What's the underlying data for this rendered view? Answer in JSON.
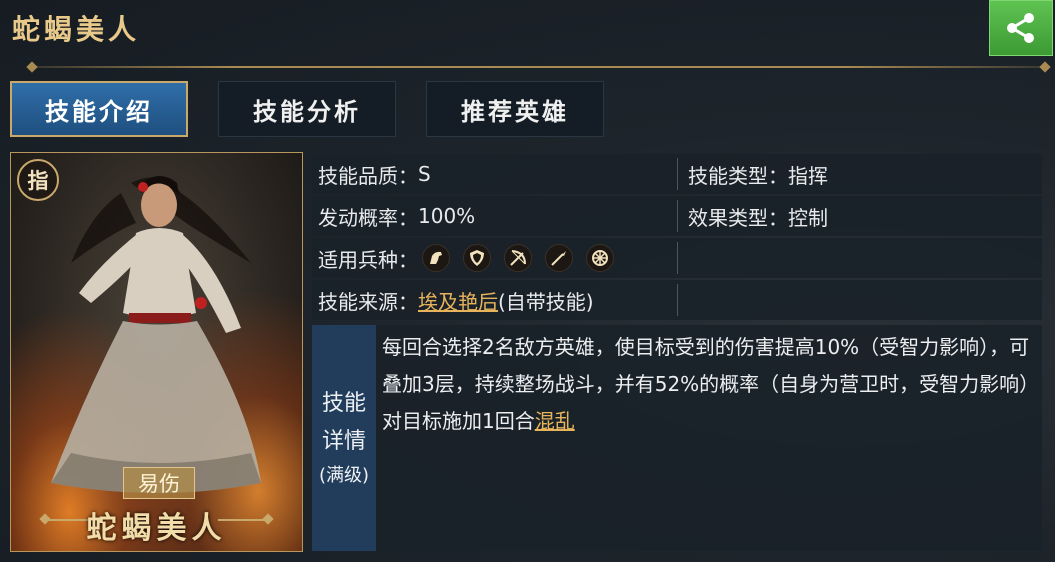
{
  "header": {
    "title": "蛇蝎美人"
  },
  "share": {
    "icon": "share-icon",
    "color": "#4caf3f"
  },
  "tabs": [
    {
      "label": "技能介绍",
      "active": true
    },
    {
      "label": "技能分析",
      "active": false
    },
    {
      "label": "推荐英雄",
      "active": false
    }
  ],
  "card": {
    "badge": "指",
    "tag": "易伤",
    "name": "蛇蝎美人"
  },
  "info": {
    "quality_label": "技能品质：",
    "quality_value": "S",
    "type_label": "技能类型：",
    "type_value": "指挥",
    "rate_label": "发动概率：",
    "rate_value": "100%",
    "effect_label": "效果类型：",
    "effect_value": "控制",
    "troops_label": "适用兵种：",
    "troops_icons": [
      "cavalry-icon",
      "shield-icon",
      "archer-icon",
      "spear-icon",
      "chariot-icon"
    ],
    "source_label": "技能来源：",
    "source_link": "埃及艳后",
    "source_suffix": "(自带技能)"
  },
  "detail": {
    "label_1": "技能",
    "label_2": "详情",
    "label_3": "(满级)",
    "text": "每回合选择2名敌方英雄，使目标受到的伤害提高10%（受智力影响），可叠加3层，持续整场战斗，并有52%的概率（自身为营卫时，受智力影响）对目标施加1回合",
    "link": "混乱"
  },
  "colors": {
    "accent_gold": "#e7b45b",
    "tab_active": "#2a6399",
    "panel": "#19212a"
  }
}
